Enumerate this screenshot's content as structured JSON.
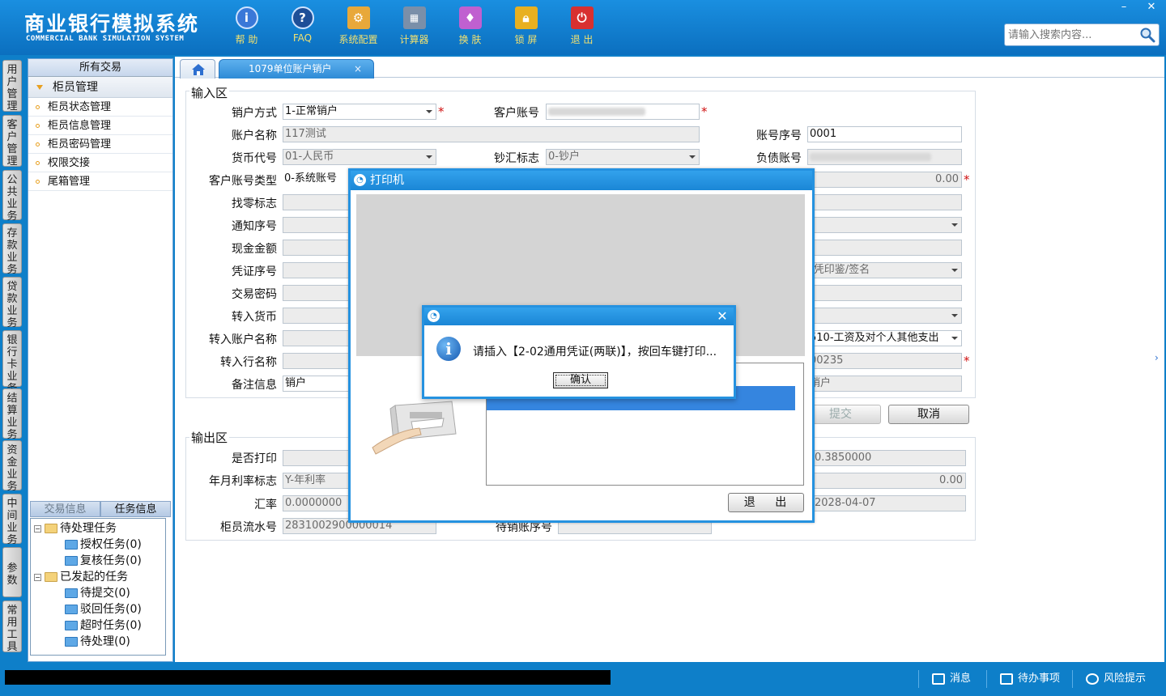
{
  "app": {
    "title_cn": "商业银行模拟系统",
    "title_en": "COMMERCIAL BANK SIMULATION SYSTEM"
  },
  "toolbar": [
    {
      "label": "帮 助",
      "icon": "help-icon",
      "color": "#3a78d8"
    },
    {
      "label": "FAQ",
      "icon": "faq-icon",
      "color": "#2a5ca8"
    },
    {
      "label": "系统配置",
      "icon": "settings-icon",
      "color": "#e8a83a"
    },
    {
      "label": "计算器",
      "icon": "calculator-icon",
      "color": "#6a7f99"
    },
    {
      "label": "换 肤",
      "icon": "skin-icon",
      "color": "#c060d0"
    },
    {
      "label": "锁 屏",
      "icon": "lock-icon",
      "color": "#e8b020"
    },
    {
      "label": "退 出",
      "icon": "power-icon",
      "color": "#d83030"
    }
  ],
  "window_controls": {
    "minimize": "–",
    "close": "✕"
  },
  "search": {
    "placeholder": "请输入搜索内容..."
  },
  "vertical_tabs": [
    "用户管理",
    "客户管理",
    "公共业务",
    "存款业务",
    "贷款业务",
    "银行卡业务",
    "结算业务",
    "资金业务",
    "中间业务",
    "参数",
    "常用工具"
  ],
  "left_panel": {
    "title": "所有交易",
    "group": "柜员管理",
    "items": [
      "柜员状态管理",
      "柜员信息管理",
      "柜员密码管理",
      "权限交接",
      "尾箱管理"
    ],
    "bottom_tabs": [
      "交易信息",
      "任务信息"
    ],
    "tree": {
      "pending": "待处理任务",
      "pending_children": [
        "授权任务(0)",
        "复核任务(0)"
      ],
      "initiated": "已发起的任务",
      "initiated_children": [
        "待提交(0)",
        "驳回任务(0)",
        "超时任务(0)",
        "待处理(0)"
      ]
    }
  },
  "tabs": {
    "active": "1079单位账户销户",
    "close": "×"
  },
  "input_section": {
    "title": "输入区",
    "labels": {
      "close_method": "销户方式",
      "customer_account": "客户账号",
      "account_name": "账户名称",
      "account_seq": "账号序号",
      "currency": "货币代号",
      "cash_flag": "钞汇标志",
      "liability_account": "负债账号",
      "account_type": "客户账号类型",
      "change_flag": "找零标志",
      "notice_no": "通知序号",
      "cash_amount": "现金金额",
      "voucher_no": "凭证序号",
      "tx_password": "交易密码",
      "transfer_currency": "转入货币",
      "transfer_account_name": "转入账户名称",
      "transfer_bank_name": "转入行名称",
      "remark": "备注信息"
    },
    "values": {
      "close_method": "1-正常销户",
      "account_name": "117测试",
      "account_seq": "0001",
      "currency": "01-人民币",
      "cash_flag": "0-钞户",
      "account_type": "0-系统账号",
      "balance": "0.00",
      "verify_method": "-凭印鉴/签名",
      "purpose": "510-工资及对个人其他支出",
      "transfer_code": "00235",
      "remark": "销户",
      "remark_right": "销户"
    },
    "required_mark": "*"
  },
  "buttons": {
    "submit": "提交",
    "cancel": "取消"
  },
  "output_section": {
    "title": "输出区",
    "labels": {
      "print_flag": "是否打印",
      "rate_flag": "年月利率标志",
      "exchange_rate": "汇率",
      "teller_serial": "柜员流水号",
      "closed_account": "待销账序号"
    },
    "values": {
      "rate_flag": "Y-年利率",
      "exchange_rate": "0.0000000",
      "teller_serial": "2831002900000014",
      "interest_rate": "0.3850000",
      "interest": "0.00",
      "date": "2028-04-07"
    }
  },
  "printer_dialog": {
    "title": "打印机",
    "quit_label": "退 出"
  },
  "message_box": {
    "text": "请插入【2-02通用凭证(两联)】，按回车键打印...",
    "ok_label": "确认",
    "close": "✕"
  },
  "status_bar": {
    "message": "消息",
    "todo": "待办事项",
    "risk": "风险提示"
  }
}
